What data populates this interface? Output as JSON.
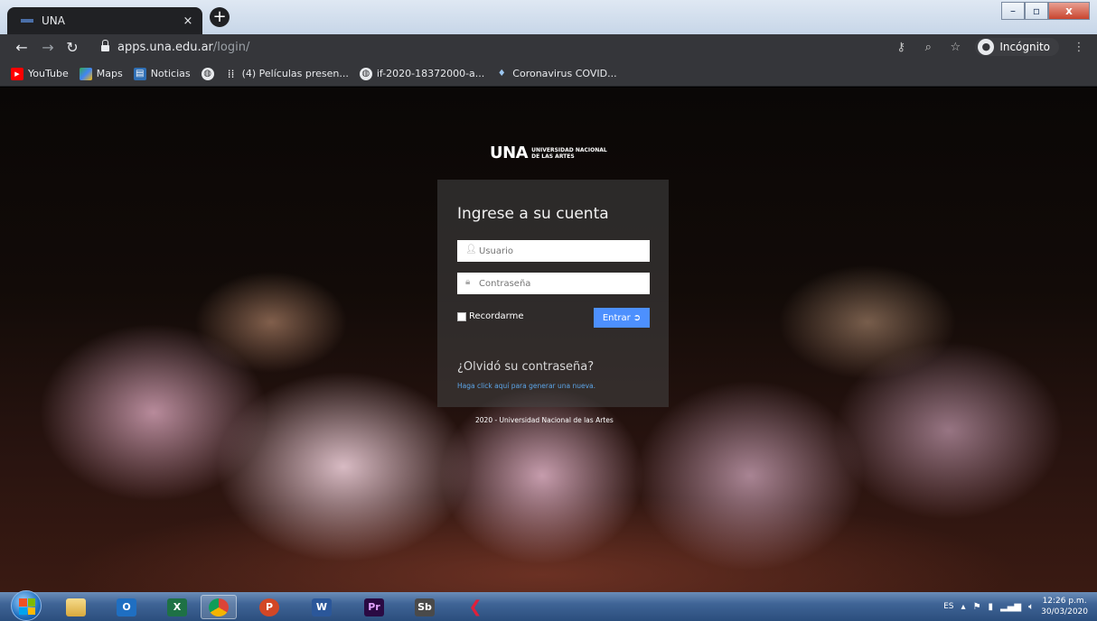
{
  "browser": {
    "tab": {
      "title": "UNA",
      "close": "×"
    },
    "new_tab": "+",
    "window_buttons": {
      "minimize": "–",
      "maximize": "▫",
      "close": "x"
    },
    "url_host": "apps.una.edu.ar",
    "url_path": "/login/",
    "incognito_label": "Incógnito",
    "bookmarks": [
      {
        "label": "YouTube",
        "icon": "youtube-icon"
      },
      {
        "label": "Maps",
        "icon": "maps-icon"
      },
      {
        "label": "Noticias",
        "icon": "news-icon"
      },
      {
        "label": "",
        "icon": "globe-icon"
      },
      {
        "label": "(4) Películas presen...",
        "icon": "dots-icon"
      },
      {
        "label": "if-2020-18372000-a...",
        "icon": "globe-icon"
      },
      {
        "label": "Coronavirus COVID...",
        "icon": "drop-icon"
      }
    ]
  },
  "logo": {
    "una": "UNA",
    "line1": "UNIVERSIDAD NACIONAL",
    "line2": "DE LAS ARTES"
  },
  "login": {
    "title": "Ingrese a su cuenta",
    "user_placeholder": "Usuario",
    "pass_placeholder": "Contraseña",
    "remember": "Recordarme",
    "submit": "Entrar",
    "forgot_title": "¿Olvidó su contraseña?",
    "forgot_link": "Haga click aquí para generar una nueva."
  },
  "footer": "2020 - Universidad Nacional de las Artes",
  "taskbar": {
    "apps": [
      {
        "name": "explorer",
        "label": ""
      },
      {
        "name": "outlook",
        "label": "O"
      },
      {
        "name": "excel",
        "label": "X"
      },
      {
        "name": "chrome",
        "label": ""
      },
      {
        "name": "powerpoint",
        "label": "P"
      },
      {
        "name": "word",
        "label": "W"
      },
      {
        "name": "premiere",
        "label": "Pr"
      },
      {
        "name": "storyboard",
        "label": "Sb"
      },
      {
        "name": "app",
        "label": ""
      }
    ],
    "lang": "ES",
    "time": "12:26 p.m.",
    "date": "30/03/2020"
  },
  "colors": {
    "accent": "#4d90fe",
    "link": "#5ca5e8",
    "toolbar": "#35363a",
    "tab": "#202124"
  }
}
